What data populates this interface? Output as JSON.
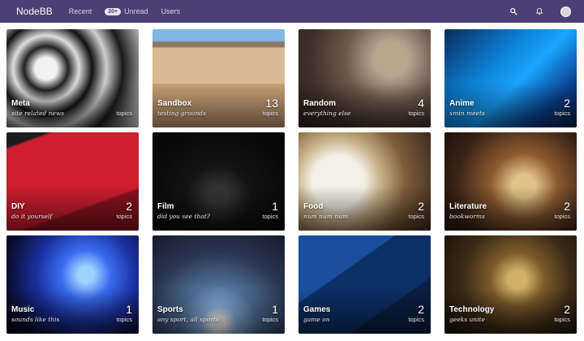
{
  "navbar": {
    "brand": "NodeBB",
    "links": [
      {
        "label": "Recent"
      },
      {
        "badge": "20+",
        "label": "Unread"
      },
      {
        "label": "Users"
      }
    ],
    "icons": [
      "search-icon",
      "bell-icon",
      "avatar"
    ]
  },
  "categories": [
    {
      "name": "Meta",
      "description": "site related news",
      "count": "",
      "topics_label": "topics",
      "bg": "bg-meta"
    },
    {
      "name": "Sandbox",
      "description": "testing grounds",
      "count": "13",
      "topics_label": "topics",
      "bg": "bg-sandbox"
    },
    {
      "name": "Random",
      "description": "everything else",
      "count": "4",
      "topics_label": "topics",
      "bg": "bg-random"
    },
    {
      "name": "Anime",
      "description": "xmin meets",
      "count": "2",
      "topics_label": "topics",
      "bg": "bg-anime"
    },
    {
      "name": "DIY",
      "description": "do it yourself",
      "count": "2",
      "topics_label": "topics",
      "bg": "bg-diy"
    },
    {
      "name": "Film",
      "description": "did you see that?",
      "count": "1",
      "topics_label": "topics",
      "bg": "bg-film"
    },
    {
      "name": "Food",
      "description": "num num num",
      "count": "2",
      "topics_label": "topics",
      "bg": "bg-food"
    },
    {
      "name": "Literature",
      "description": "bookworms",
      "count": "2",
      "topics_label": "topics",
      "bg": "bg-literature"
    },
    {
      "name": "Music",
      "description": "sounds like this",
      "count": "1",
      "topics_label": "topics",
      "bg": "bg-music"
    },
    {
      "name": "Sports",
      "description": "any sport, all sports",
      "count": "1",
      "topics_label": "topics",
      "bg": "bg-sports"
    },
    {
      "name": "Games",
      "description": "game on",
      "count": "2",
      "topics_label": "topics",
      "bg": "bg-games"
    },
    {
      "name": "Technology",
      "description": "geeks unite",
      "count": "2",
      "topics_label": "topics",
      "bg": "bg-technology"
    }
  ]
}
